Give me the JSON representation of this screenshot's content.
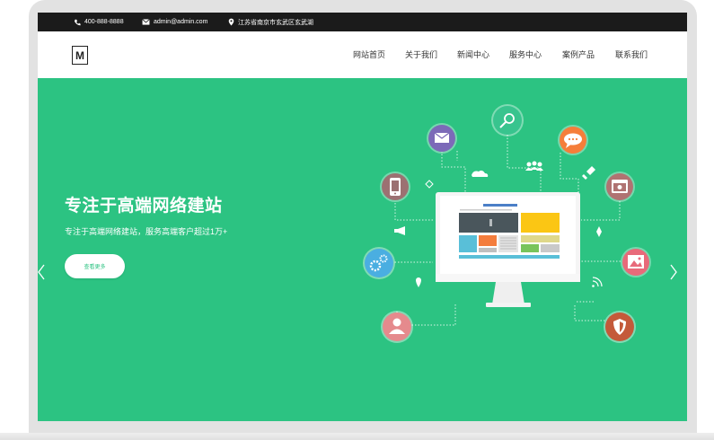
{
  "topbar": {
    "phone": "400-888-8888",
    "email": "admin@admin.com",
    "address": "江苏省南京市玄武区玄武湖",
    "icons": [
      "phone-icon",
      "mail-icon",
      "location-pin-icon"
    ]
  },
  "logo": {
    "letter": "M"
  },
  "nav": {
    "items": [
      "网站首页",
      "关于我们",
      "新闻中心",
      "服务中心",
      "案例产品",
      "联系我们"
    ]
  },
  "hero": {
    "title": "专注于高端网络建站",
    "subtitle": "专注于高端网络建站，服务高端客户超过1万+",
    "button": "查看更多",
    "prev_icon": "chevron-left-icon",
    "next_icon": "chevron-right-icon"
  },
  "colors": {
    "hero_bg": "#2cc382",
    "topbar_bg": "#1b1b1b",
    "frame": "#e2e2e2",
    "icon_mail": "#7c6ab8",
    "icon_search": "#38c48e",
    "icon_chat": "#f57e3a",
    "icon_phone": "#9c7172",
    "icon_monitor": "#b07372",
    "icon_gears": "#4aaee1",
    "icon_image": "#e86a7a",
    "icon_user": "#e58a8d",
    "icon_shield": "#c45a3a"
  }
}
